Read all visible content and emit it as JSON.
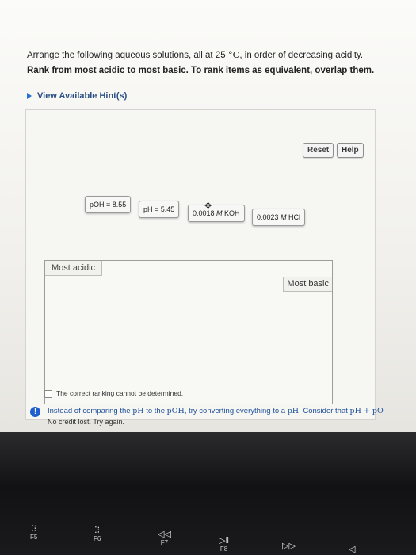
{
  "question": {
    "line1_pre": "Arrange the following aqueous solutions, all at 25 ",
    "line1_unit": "°C",
    "line1_post": ", in order of decreasing acidity.",
    "line2": "Rank from most acidic to most basic. To rank items as equivalent, overlap them."
  },
  "hint": {
    "label": "View Available Hint(s)"
  },
  "buttons": {
    "reset": "Reset",
    "help": "Help"
  },
  "items": [
    {
      "text": "pOH = 8.55"
    },
    {
      "text": "pH = 5.45"
    },
    {
      "pre": "0.0018 ",
      "unit": "M",
      "post": " KOH"
    },
    {
      "pre": "0.0023 ",
      "unit": "M",
      "post": " HCl"
    }
  ],
  "rank": {
    "left_label": "Most acidic",
    "right_label": "Most basic"
  },
  "cannot_determine": "The correct ranking cannot be determined.",
  "feedback": {
    "part1": "Instead of comparing the ",
    "m1": "pH",
    "part2": " to the ",
    "m2": "pOH",
    "part3": ", try converting everything to a ",
    "m3": "pH",
    "part4": ". Consider that ",
    "m4": "pH + pO",
    "icon_text": "!"
  },
  "no_credit": "No credit lost. Try again.",
  "keyboard": {
    "f5": "F5",
    "f6": "F6",
    "f7": "F7",
    "f8": "F8",
    "f5_icon": "keyboard-backlight-down",
    "f6_icon": "keyboard-backlight-up",
    "f7_sym": "◁◁",
    "f8_sym": "▷‖",
    "f9_sym": "▷▷",
    "f10_sym": "◁"
  },
  "colors": {
    "hint_link": "#2a4f86",
    "feedback_text": "#1f4f9a",
    "feedback_icon": "#1f5fcf"
  }
}
